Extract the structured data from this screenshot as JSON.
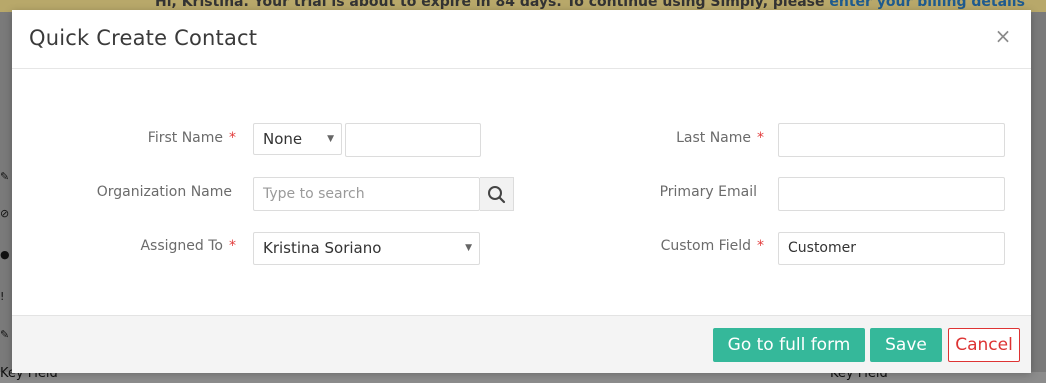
{
  "background": {
    "banner_text": "Hi, Kristina. Your trial is about to expire in 84 days. To continue using Simply, please ",
    "banner_link": "enter your billing details",
    "key_field_left": "Key Field",
    "key_field_right": "Key Field"
  },
  "modal": {
    "title": "Quick Create Contact",
    "close_glyph": "×"
  },
  "form": {
    "first_name": {
      "label": "First Name",
      "required_mark": "*",
      "salutation": "None",
      "value": ""
    },
    "last_name": {
      "label": "Last Name",
      "required_mark": "*",
      "value": ""
    },
    "organization": {
      "label": "Organization Name",
      "placeholder": "Type to search"
    },
    "primary_email": {
      "label": "Primary Email",
      "value": ""
    },
    "assigned_to": {
      "label": "Assigned To",
      "required_mark": "*",
      "value": "Kristina Soriano"
    },
    "custom_field": {
      "label": "Custom Field",
      "required_mark": "*",
      "value": "Customer"
    }
  },
  "footer": {
    "full_form_label": "Go to full form",
    "save_label": "Save",
    "cancel_label": "Cancel"
  },
  "colors": {
    "accent": "#35b89a",
    "cancel": "#dd3333",
    "required": "#e23c3c"
  }
}
